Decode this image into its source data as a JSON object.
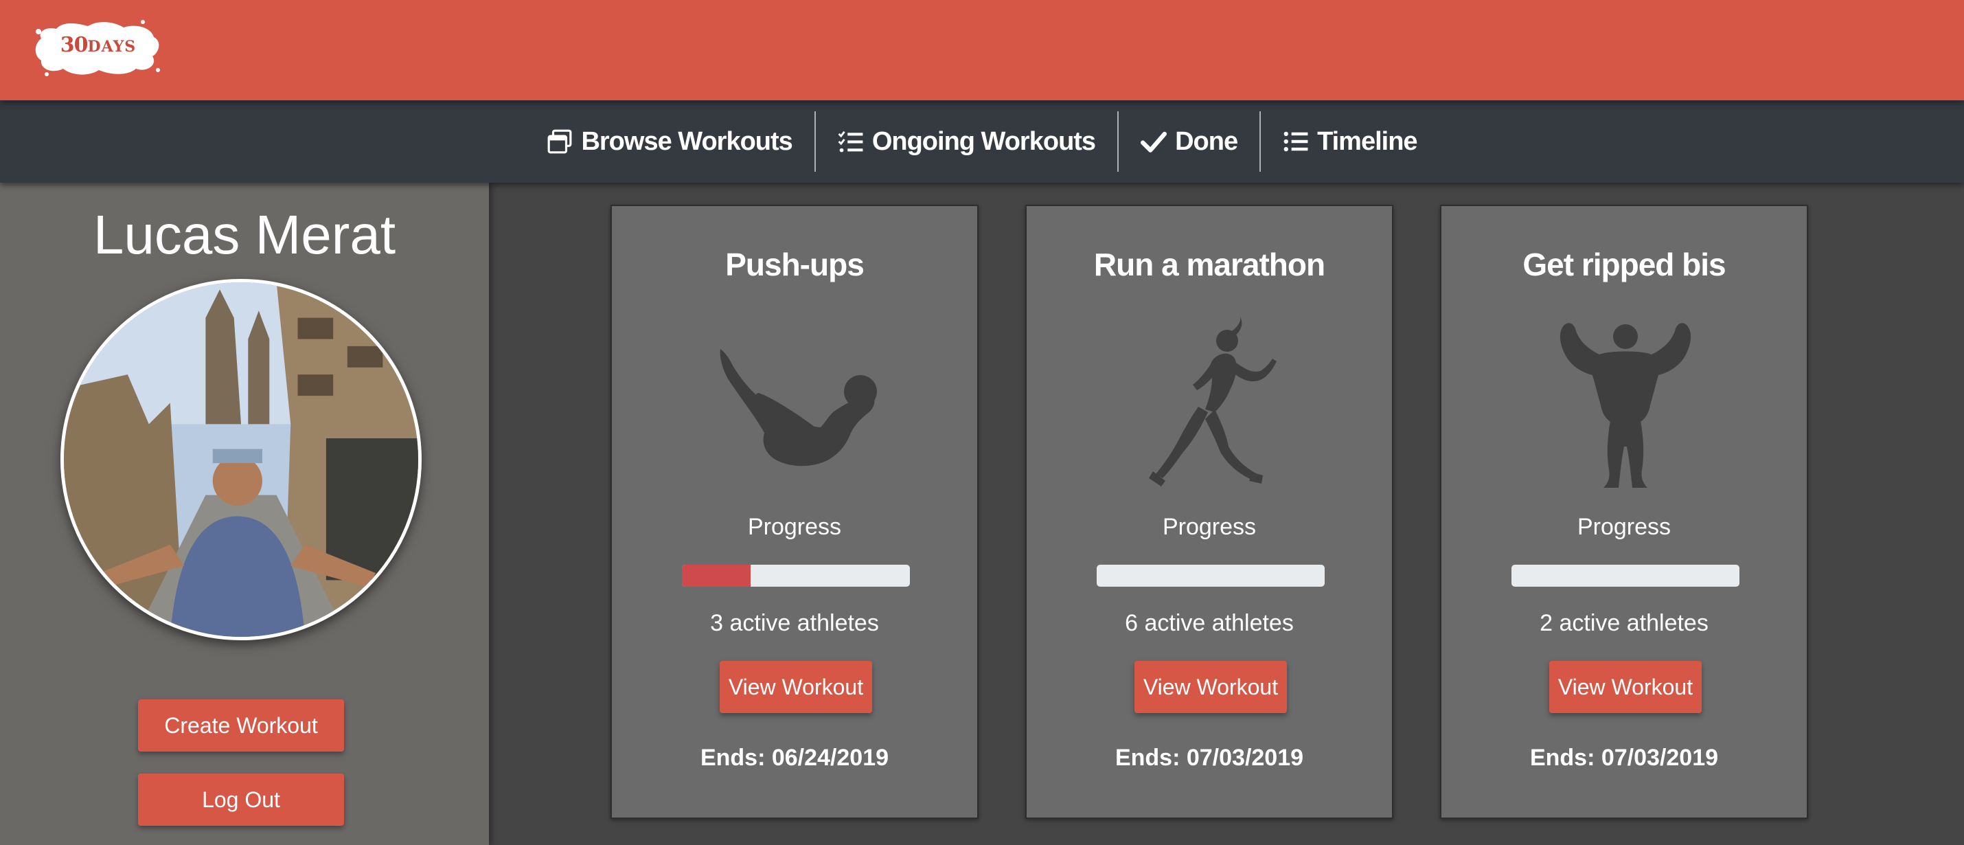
{
  "brand": {
    "logo_number": "30",
    "logo_word": "DAYS"
  },
  "nav": {
    "items": [
      {
        "label": "Browse Workouts",
        "icon": "windows-icon"
      },
      {
        "label": "Ongoing Workouts",
        "icon": "checklist-icon"
      },
      {
        "label": "Done",
        "icon": "check-icon"
      },
      {
        "label": "Timeline",
        "icon": "list-icon"
      }
    ]
  },
  "sidebar": {
    "user_name": "Lucas Merat",
    "create_label": "Create Workout",
    "logout_label": "Log Out"
  },
  "workouts": [
    {
      "title": "Push-ups",
      "figure": "pushup-figure-icon",
      "progress_label": "Progress",
      "progress_fraction": 0.3,
      "athletes": "3 active athletes",
      "button_label": "View Workout",
      "ends": "Ends: 06/24/2019"
    },
    {
      "title": "Run a marathon",
      "figure": "runner-figure-icon",
      "progress_label": "Progress",
      "progress_fraction": 0.0,
      "athletes": "6 active athletes",
      "button_label": "View Workout",
      "ends": "Ends: 07/03/2019"
    },
    {
      "title": "Get ripped bis",
      "figure": "bodybuilder-figure-icon",
      "progress_label": "Progress",
      "progress_fraction": 0.0,
      "athletes": "2 active athletes",
      "button_label": "View Workout",
      "ends": "Ends: 07/03/2019"
    }
  ],
  "colors": {
    "brand_red": "#d65746",
    "navbar": "#343a40",
    "sidebar": "#6b6966",
    "card": "#6b6b6b",
    "progress_fill": "#cf4a4d",
    "progress_track": "#e9ecef"
  }
}
